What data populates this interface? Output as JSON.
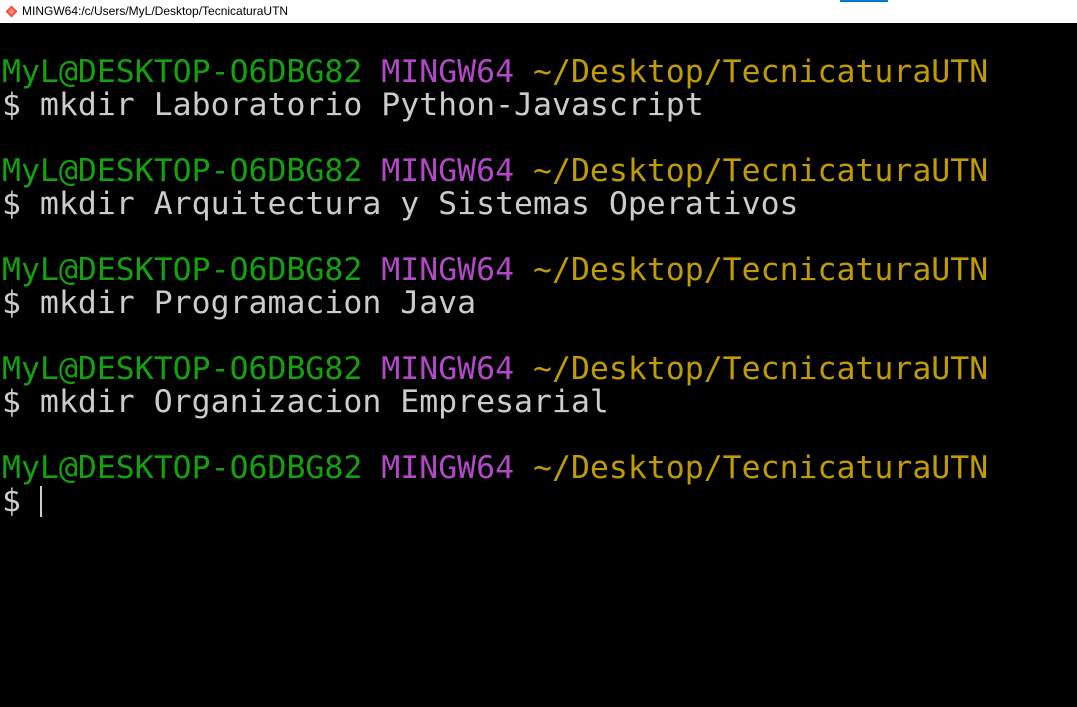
{
  "window": {
    "title": "MINGW64:/c/Users/MyL/Desktop/TecnicaturaUTN",
    "icon": "git-bash-icon"
  },
  "colors": {
    "background": "#000000",
    "user_host": "#13a10e",
    "environment": "#b148c6",
    "path": "#c19c00",
    "command": "#cccccc"
  },
  "terminal": {
    "entries": [
      {
        "user_host": "MyL@DESKTOP-O6DBG82",
        "env": "MINGW64",
        "path": "~/Desktop/TecnicaturaUTN",
        "command": "$ mkdir Laboratorio Python-Javascript"
      },
      {
        "user_host": "MyL@DESKTOP-O6DBG82",
        "env": "MINGW64",
        "path": "~/Desktop/TecnicaturaUTN",
        "command": "$ mkdir Arquitectura y Sistemas Operativos"
      },
      {
        "user_host": "MyL@DESKTOP-O6DBG82",
        "env": "MINGW64",
        "path": "~/Desktop/TecnicaturaUTN",
        "command": "$ mkdir Programacion Java"
      },
      {
        "user_host": "MyL@DESKTOP-O6DBG82",
        "env": "MINGW64",
        "path": "~/Desktop/TecnicaturaUTN",
        "command": "$ mkdir Organizacion Empresarial"
      },
      {
        "user_host": "MyL@DESKTOP-O6DBG82",
        "env": "MINGW64",
        "path": "~/Desktop/TecnicaturaUTN",
        "command": "$ "
      }
    ]
  }
}
